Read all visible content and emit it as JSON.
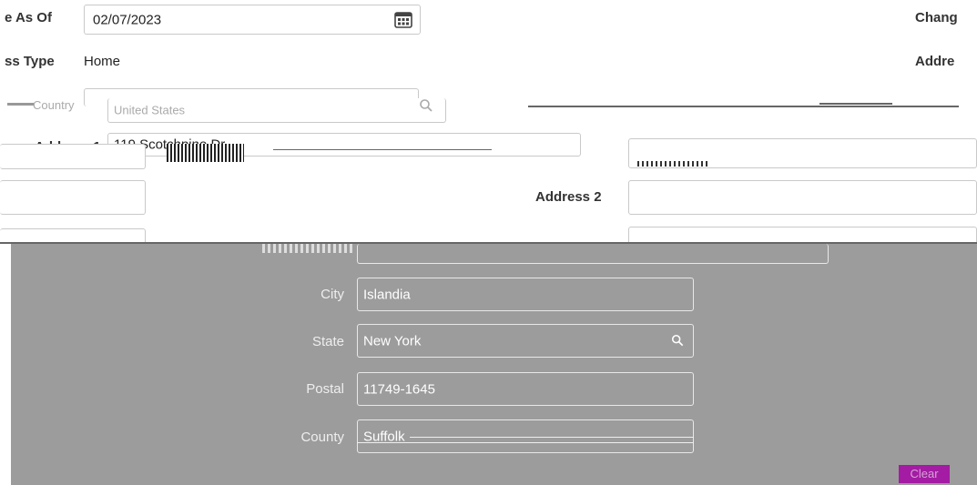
{
  "header": {
    "effective_label": "e As Of",
    "effective_value": "02/07/2023",
    "change_label": "Chang",
    "type_label": "ss Type",
    "type_value": "Home",
    "address_right_label": "Addre"
  },
  "form": {
    "country_label": "Country",
    "country_value": "United States",
    "address1_label": "Address 1",
    "address1_value": "119 Scotchpine Dr",
    "address2_label": "Address 2",
    "address2_value": ""
  },
  "dialog": {
    "city_label": "City",
    "city_value": "Islandia",
    "state_label": "State",
    "state_value": "New York",
    "postal_label": "Postal",
    "postal_value": "11749-1645",
    "county_label": "County",
    "county_value": "Suffolk",
    "clear_label": "Clear"
  },
  "icons": {
    "calendar": "calendar-icon",
    "search": "search-icon"
  },
  "colors": {
    "dialog_bg": "#9c9c9c",
    "accent_button": "#a31ca3"
  }
}
